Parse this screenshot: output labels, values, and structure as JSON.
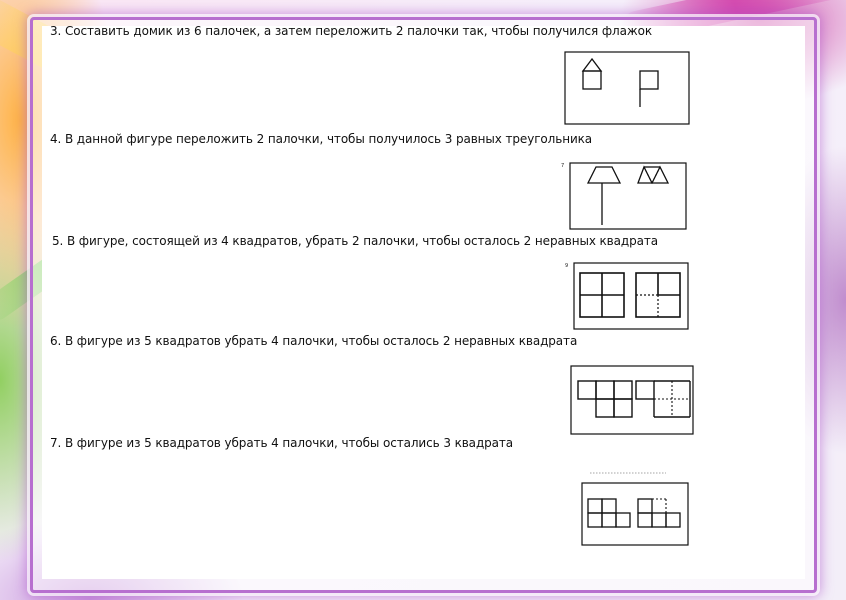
{
  "tasks": [
    {
      "id": "task-3",
      "text": "3. Составить домик из 6 палочек, а затем переложить 2 палочки так, чтобы получился флажок"
    },
    {
      "id": "task-4",
      "text": "4. В данной фигуре переложить 2 палочки, чтобы получилось 3 равных треугольника",
      "figure_number": "7"
    },
    {
      "id": "task-5",
      "text": "5. В фигуре, состоящей из 4 квадратов, убрать 2 палочки, чтобы осталось 2 неравных квадрата",
      "figure_number": "9"
    },
    {
      "id": "task-6",
      "text": "6. В фигуре из 5 квадратов убрать 4 палочки, чтобы осталось 2 неравных квадрата"
    },
    {
      "id": "task-7",
      "text": "7. В фигуре из 5 квадратов убрать 4 палочки, чтобы остались 3 квадрата"
    }
  ],
  "colors": {
    "frame": "#b76fcf",
    "ink": "#111111"
  }
}
